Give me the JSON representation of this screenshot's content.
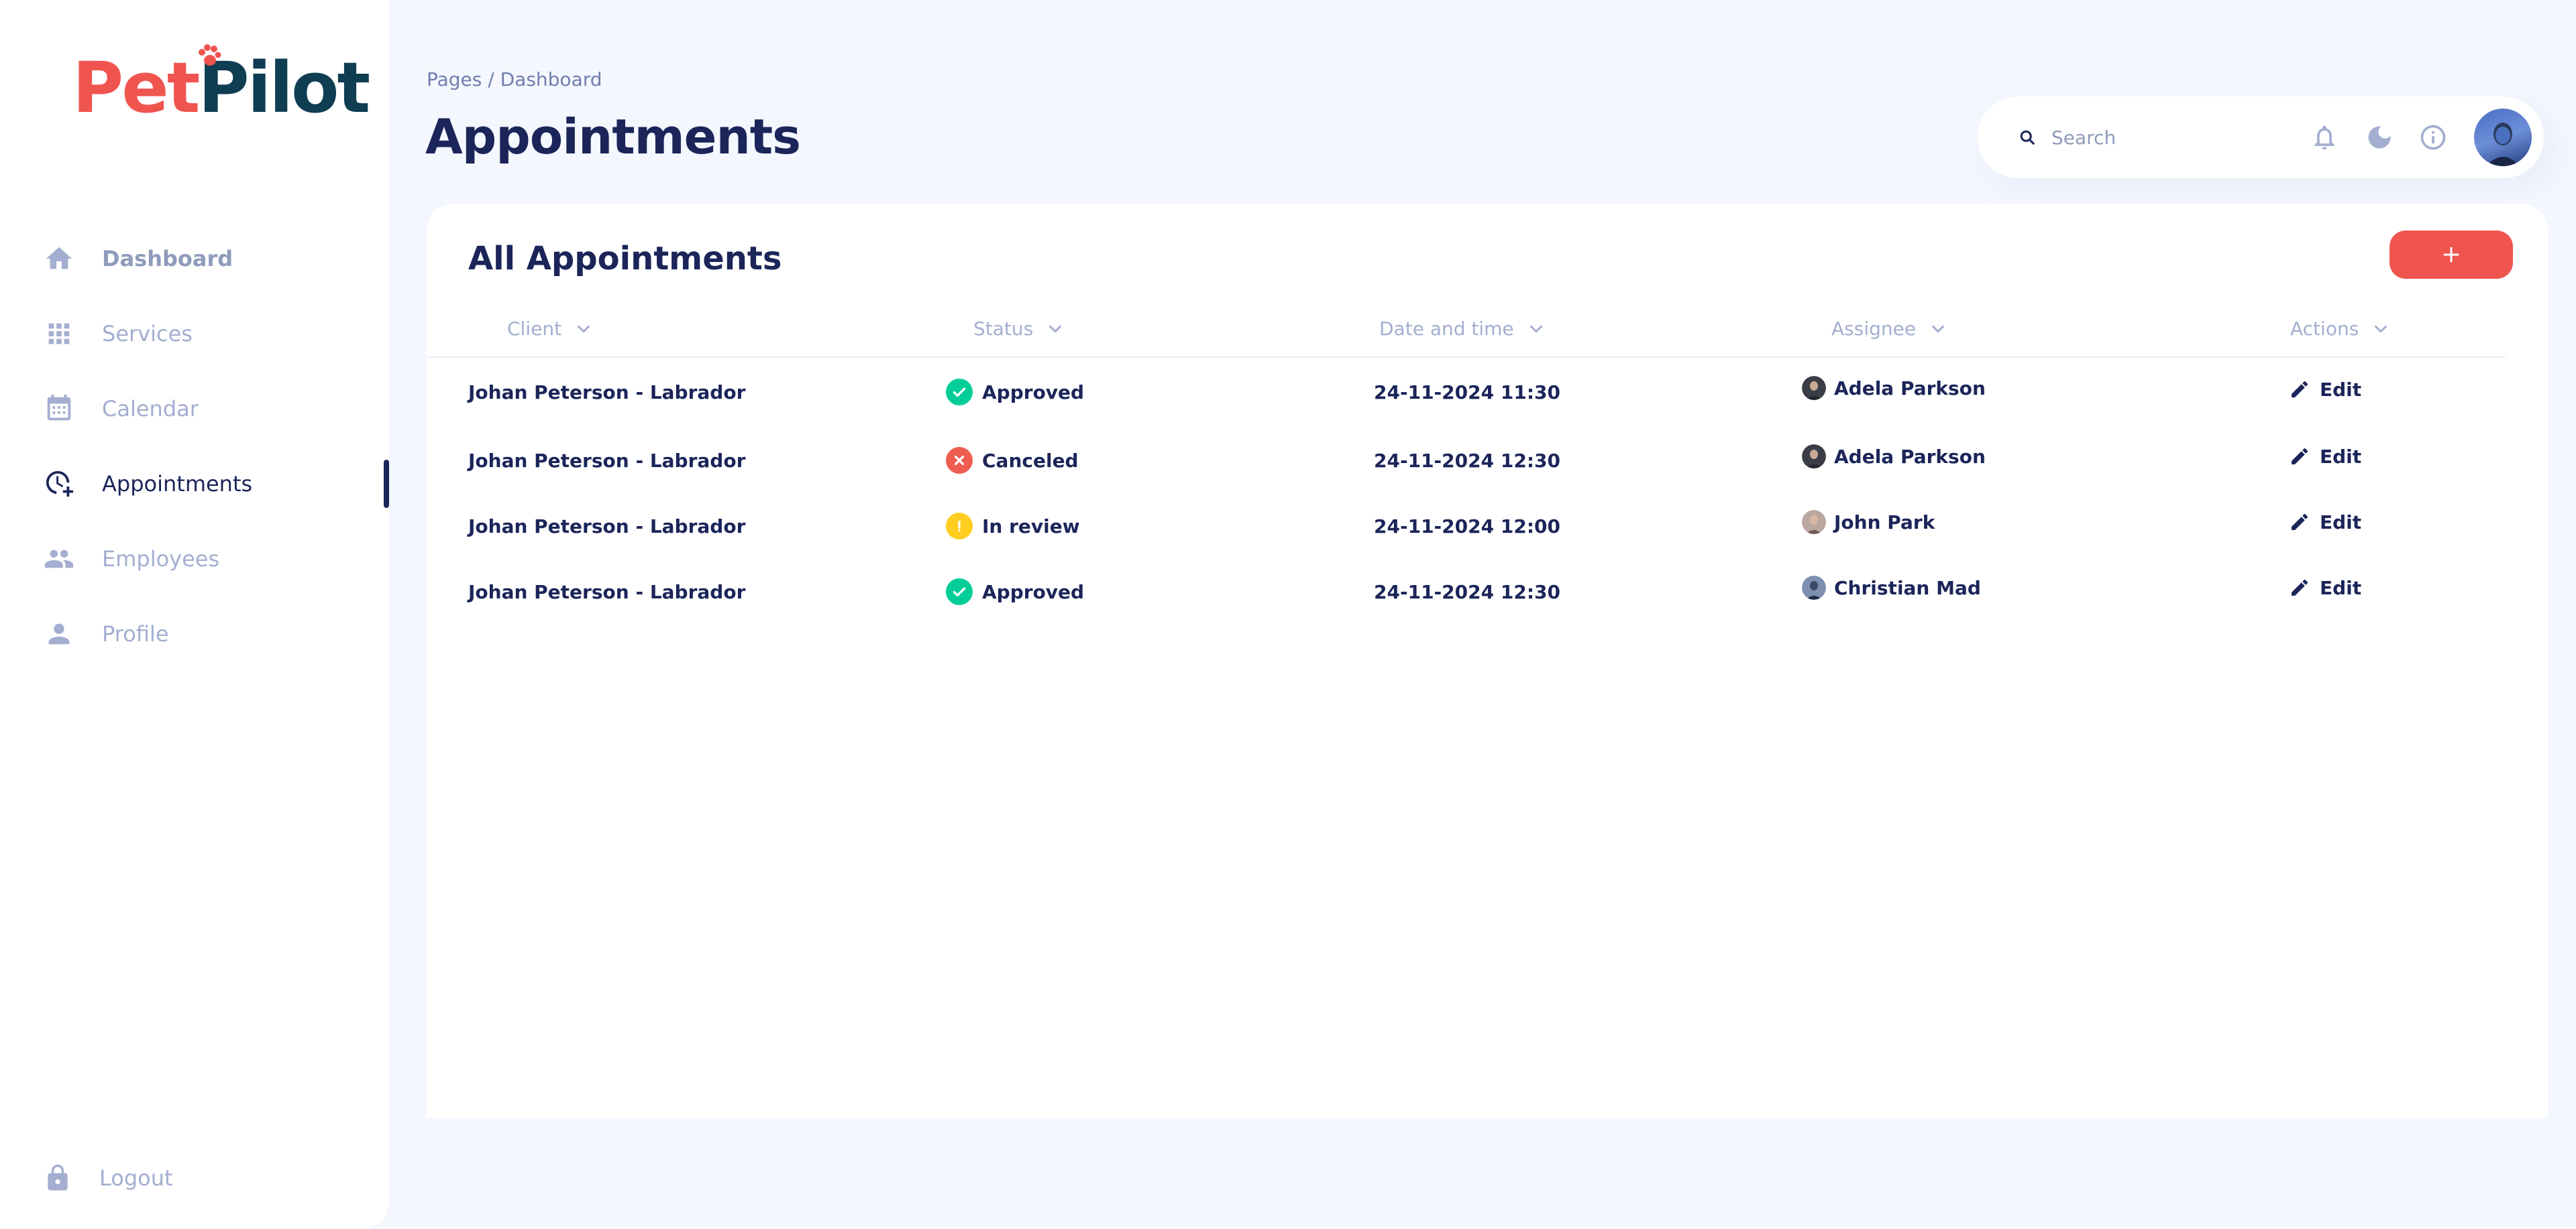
{
  "brand": {
    "part1": "Pet",
    "part2": "Pilot",
    "accent": "#f0544f",
    "dark": "#0f3d52"
  },
  "sidebar": {
    "items": [
      {
        "label": "Dashboard",
        "icon": "home-icon"
      },
      {
        "label": "Services",
        "icon": "grid-icon"
      },
      {
        "label": "Calendar",
        "icon": "calendar-icon"
      },
      {
        "label": "Appointments",
        "icon": "clock-plus-icon",
        "active": true
      },
      {
        "label": "Employees",
        "icon": "people-icon"
      },
      {
        "label": "Profile",
        "icon": "person-icon"
      }
    ],
    "logout": "Logout"
  },
  "header": {
    "breadcrumb": "Pages / Dashboard",
    "title": "Appointments",
    "search_placeholder": "Search"
  },
  "card": {
    "title": "All Appointments",
    "add_label": "+",
    "columns": [
      "Client",
      "Status",
      "Date and time",
      "Assignee",
      "Actions"
    ],
    "rows": [
      {
        "client": "Johan Peterson - Labrador",
        "status": "Approved",
        "status_color": "#05cd99",
        "datetime": "24-11-2024 11:30",
        "assignee": "Adela Parkson",
        "action": "Edit"
      },
      {
        "client": "Johan Peterson - Labrador",
        "status": "Canceled",
        "status_color": "#ee5d50",
        "datetime": "24-11-2024 12:30",
        "assignee": "Adela Parkson",
        "action": "Edit"
      },
      {
        "client": "Johan Peterson - Labrador",
        "status": "In review",
        "status_color": "#ffce20",
        "datetime": "24-11-2024 12:00",
        "assignee": "John Park",
        "action": "Edit"
      },
      {
        "client": "Johan Peterson - Labrador",
        "status": "Approved",
        "status_color": "#05cd99",
        "datetime": "24-11-2024 12:30",
        "assignee": "Christian Mad",
        "action": "Edit"
      }
    ]
  }
}
